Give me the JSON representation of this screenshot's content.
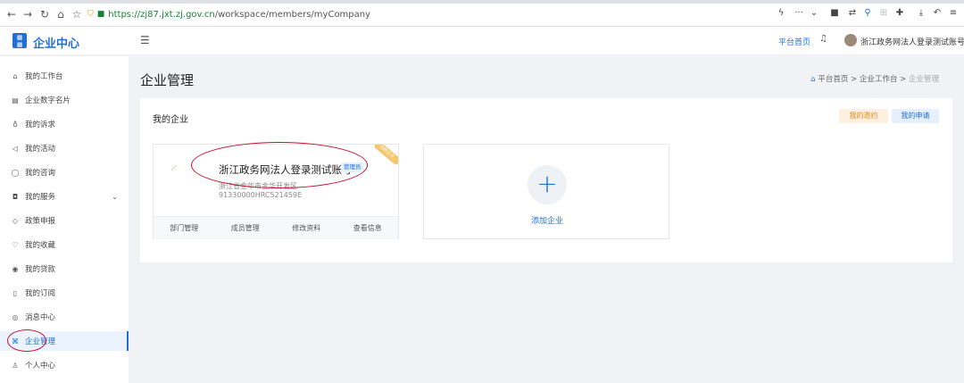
{
  "browser": {
    "url_scheme": "https://",
    "url_host": "zj87.jxt.zj.gov.cn",
    "url_path": "/workspace/members/myCompany"
  },
  "header": {
    "app_title": "企业中心",
    "platform_home": "平台首页",
    "user_name": "浙江政务网法人登录测试账号"
  },
  "sidebar": {
    "items": [
      {
        "label": "我的工作台",
        "icon": "home-icon"
      },
      {
        "label": "企业数字名片",
        "icon": "card-icon"
      },
      {
        "label": "我的诉求",
        "icon": "mic-icon"
      },
      {
        "label": "我的活动",
        "icon": "megaphone-icon"
      },
      {
        "label": "我的咨询",
        "icon": "chat-icon"
      },
      {
        "label": "我的服务",
        "icon": "bag-icon"
      },
      {
        "label": "政策申报",
        "icon": "tag-icon"
      },
      {
        "label": "我的收藏",
        "icon": "heart-icon"
      },
      {
        "label": "我的贷款",
        "icon": "coin-icon"
      },
      {
        "label": "我的订阅",
        "icon": "doc-icon"
      },
      {
        "label": "消息中心",
        "icon": "message-icon"
      },
      {
        "label": "企业管理",
        "icon": "building-icon"
      },
      {
        "label": "个人中心",
        "icon": "user-icon"
      }
    ]
  },
  "main": {
    "page_title": "企业管理",
    "breadcrumb": {
      "home": "平台首页",
      "sep1": ">",
      "middle": "企业工作台",
      "sep2": ">",
      "current": "企业管理"
    },
    "panel_title": "我的企业",
    "invite_button": "我的邀约",
    "apply_button": "我的申请",
    "company": {
      "name": "浙江政务网法人登录测试账号",
      "role_badge": "管理员",
      "ribbon": "当前企业",
      "address": "浙江省金华市金华开发区",
      "code": "91330000HRC521459E",
      "actions": [
        "部门管理",
        "成员管理",
        "修改资料",
        "查看信息"
      ]
    },
    "add_company": {
      "plus": "+",
      "label": "添加企业"
    }
  },
  "colors": {
    "accent": "#1f6fd6",
    "annotation_red": "#c8102e",
    "invite_bg": "#fdf0e0",
    "invite_text": "#e08b1e"
  }
}
